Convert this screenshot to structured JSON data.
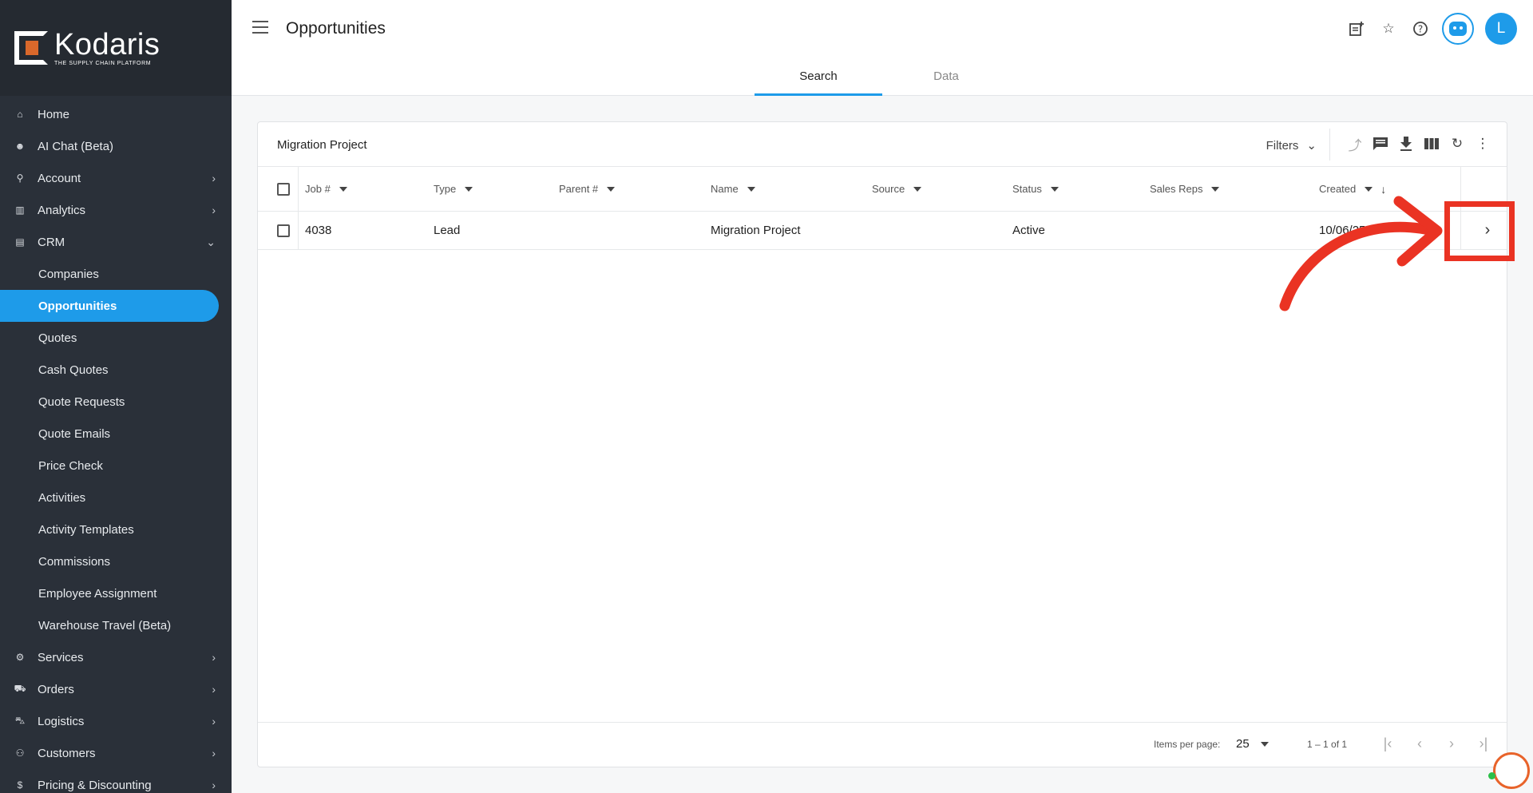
{
  "brand": {
    "name": "Kodaris",
    "tagline": "THE SUPPLY CHAIN PLATFORM",
    "accent": "#1e9be9",
    "logo_orange": "#d9682b"
  },
  "sidebar": {
    "items": [
      {
        "label": "Home",
        "icon": "home-icon"
      },
      {
        "label": "AI Chat (Beta)",
        "icon": "robot-icon"
      },
      {
        "label": "Account",
        "icon": "person-icon",
        "expandable": true
      },
      {
        "label": "Analytics",
        "icon": "chart-icon",
        "expandable": true
      },
      {
        "label": "CRM",
        "icon": "contacts-icon",
        "expanded": true
      },
      {
        "label": "Companies",
        "sub": true
      },
      {
        "label": "Opportunities",
        "sub": true,
        "active": true
      },
      {
        "label": "Quotes",
        "sub": true
      },
      {
        "label": "Cash Quotes",
        "sub": true
      },
      {
        "label": "Quote Requests",
        "sub": true
      },
      {
        "label": "Quote Emails",
        "sub": true
      },
      {
        "label": "Price Check",
        "sub": true
      },
      {
        "label": "Activities",
        "sub": true
      },
      {
        "label": "Activity Templates",
        "sub": true
      },
      {
        "label": "Commissions",
        "sub": true
      },
      {
        "label": "Employee Assignment",
        "sub": true
      },
      {
        "label": "Warehouse Travel (Beta)",
        "sub": true
      },
      {
        "label": "Services",
        "icon": "gears-icon",
        "expandable": true
      },
      {
        "label": "Orders",
        "icon": "truck-icon",
        "expandable": true
      },
      {
        "label": "Logistics",
        "icon": "delivery-icon",
        "expandable": true
      },
      {
        "label": "Customers",
        "icon": "people-icon",
        "expandable": true
      },
      {
        "label": "Pricing & Discounting",
        "icon": "dollar-icon",
        "expandable": true
      }
    ]
  },
  "header": {
    "title": "Opportunities",
    "avatar_initial": "L",
    "tabs": [
      {
        "label": "Search",
        "active": true
      },
      {
        "label": "Data"
      }
    ]
  },
  "card": {
    "title": "Migration Project",
    "filters_label": "Filters",
    "columns": [
      "Job #",
      "Type",
      "Parent #",
      "Name",
      "Source",
      "Status",
      "Sales Reps",
      "Created"
    ],
    "rows": [
      {
        "job": "4038",
        "type": "Lead",
        "parent": "",
        "name": "Migration Project",
        "source": "",
        "status": "Active",
        "sales_reps": "",
        "created": "10/06/25"
      }
    ],
    "footer": {
      "items_per_page_label": "Items per page:",
      "items_per_page": "25",
      "range": "1 – 1 of 1"
    }
  },
  "annotation_color": "#ea3323"
}
